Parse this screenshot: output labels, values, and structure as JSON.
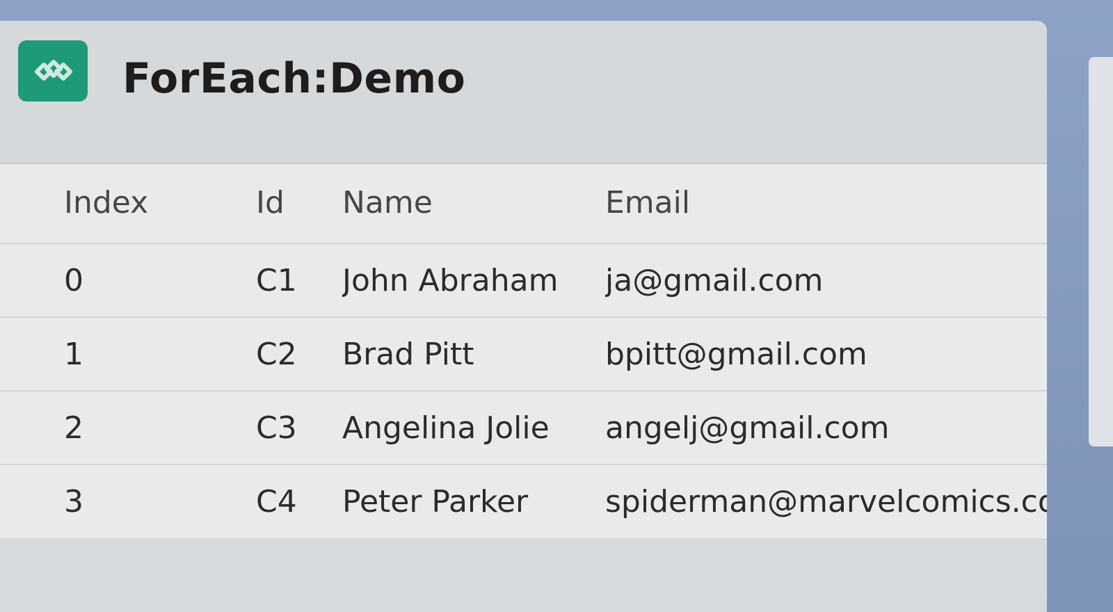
{
  "app": {
    "title": "ForEach:Demo",
    "logo_icon": "diamond-chain-icon",
    "accent_color": "#1f9a78"
  },
  "table": {
    "columns": [
      "Index",
      "Id",
      "Name",
      "Email"
    ],
    "rows": [
      {
        "index": "0",
        "id": "C1",
        "name": "John Abraham",
        "email": "ja@gmail.com"
      },
      {
        "index": "1",
        "id": "C2",
        "name": "Brad Pitt",
        "email": "bpitt@gmail.com"
      },
      {
        "index": "2",
        "id": "C3",
        "name": "Angelina Jolie",
        "email": "angelj@gmail.com"
      },
      {
        "index": "3",
        "id": "C4",
        "name": "Peter Parker",
        "email": "spiderman@marvelcomics.com"
      }
    ]
  }
}
